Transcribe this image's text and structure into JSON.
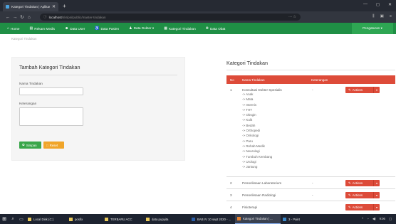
{
  "browser": {
    "tab_title": "Kategori Tindakan | Aplikasi R...",
    "url_host": "localhost",
    "url_rest": "/skripsi/public/master-tindakan"
  },
  "appnav": {
    "items": [
      {
        "label": "Home",
        "icon": "home-icon"
      },
      {
        "label": "Rekam Medis",
        "icon": "medical-record-icon"
      },
      {
        "label": "Data User",
        "icon": "users-icon"
      },
      {
        "label": "Data Pasien",
        "icon": "patient-icon"
      },
      {
        "label": "Data Dokter ▾",
        "icon": "doctor-icon"
      },
      {
        "label": "Kategori Tindakan",
        "icon": "category-icon"
      },
      {
        "label": "Data Obat",
        "icon": "medicine-icon"
      }
    ],
    "settings_label": "Pengaturan ▾"
  },
  "breadcrumb": "Kategori Tindakan",
  "form": {
    "title": "Tambah Kategori Tindakan",
    "nama_label": "Nama Tindakan",
    "ket_label": "Keterangan",
    "save_label": "Simpan",
    "reset_label": "Reset"
  },
  "table": {
    "title": "Kategori Tindakan",
    "headers": {
      "no": "No",
      "nama": "Nama Tindakan",
      "ket": "Keterangan"
    },
    "action_label": "Actions",
    "rows": [
      {
        "no": "1",
        "nama": "Konsultasi Dokter Spesialis",
        "ket": "-",
        "subs": [
          "-> Anak",
          "-> Mata",
          "-> Internis",
          "-> THT",
          "-> Obsgin",
          "-> Kulit",
          "-> Bedah",
          "-> Orthopedi",
          "-> Onkologi",
          "-> Paru",
          "-> Rehab Medik",
          "-> Neurologi",
          "-> Tumbuh Kembang",
          "-> Urologi",
          "-> Jantung"
        ]
      },
      {
        "no": "2",
        "nama": "Pemeriksaan Laboratorium",
        "ket": "-"
      },
      {
        "no": "3",
        "nama": "Pemeriksaan Radiologi",
        "ket": "-"
      },
      {
        "no": "4",
        "nama": "Fisioterapi",
        "ket": ""
      }
    ]
  },
  "taskbar": {
    "items": [
      {
        "label": "Local Disk (C:)",
        "color": "#e8c85a"
      },
      {
        "label": "posfix",
        "color": "#e8c85a"
      },
      {
        "label": "TERBARU ACC",
        "color": "#e8c85a"
      },
      {
        "label": "data pupyita",
        "color": "#e8c85a"
      },
      {
        "label": "BAB IV 10 sept 2020 - ...",
        "color": "#2b5ea8"
      },
      {
        "label": "Kategori Tindakan | ...",
        "color": "#e5822f"
      },
      {
        "label": "3 - Paint",
        "color": "#3a88c8"
      }
    ],
    "time": "9:06"
  }
}
